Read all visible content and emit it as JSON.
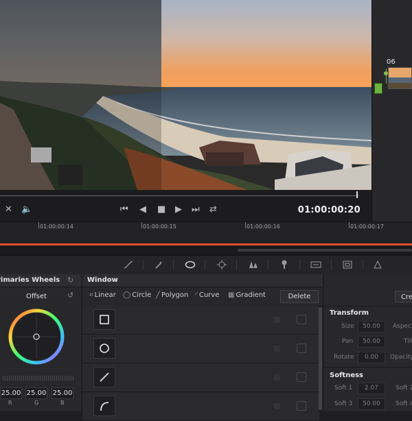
{
  "viewer": {
    "node_label": "06"
  },
  "transport": {
    "timecode": "01:00:00:20"
  },
  "timeline": {
    "ticks": [
      "01:00:00:14",
      "01:00:00:15",
      "01:00:00:16",
      "01:00:00:17"
    ]
  },
  "primaries": {
    "title": "rimaries Wheels",
    "wheel_label": "Offset",
    "values": [
      "25.00",
      "25.00",
      "25.00"
    ],
    "channels": [
      "R",
      "G",
      "B"
    ]
  },
  "window_panel": {
    "title": "Window",
    "shapes": [
      "Linear",
      "Circle",
      "Polygon",
      "Curve",
      "Gradient"
    ],
    "delete_label": "Delete"
  },
  "right_panel": {
    "create_label": "Crea",
    "transform_title": "Transform",
    "size_label": "Size",
    "size_value": "50.00",
    "aspect_label": "Aspec",
    "pan_label": "Pan",
    "pan_value": "50.00",
    "tilt_label": "Tilt",
    "rotate_label": "Rotate",
    "rotate_value": "0.00",
    "opacity_label": "Opacity",
    "softness_title": "Softness",
    "soft1_label": "Soft 1",
    "soft1_value": "2.07",
    "soft2_label": "Soft 2",
    "soft3_label": "Soft 3",
    "soft3_value": "50.00",
    "soft4_label": "Soft 4"
  }
}
